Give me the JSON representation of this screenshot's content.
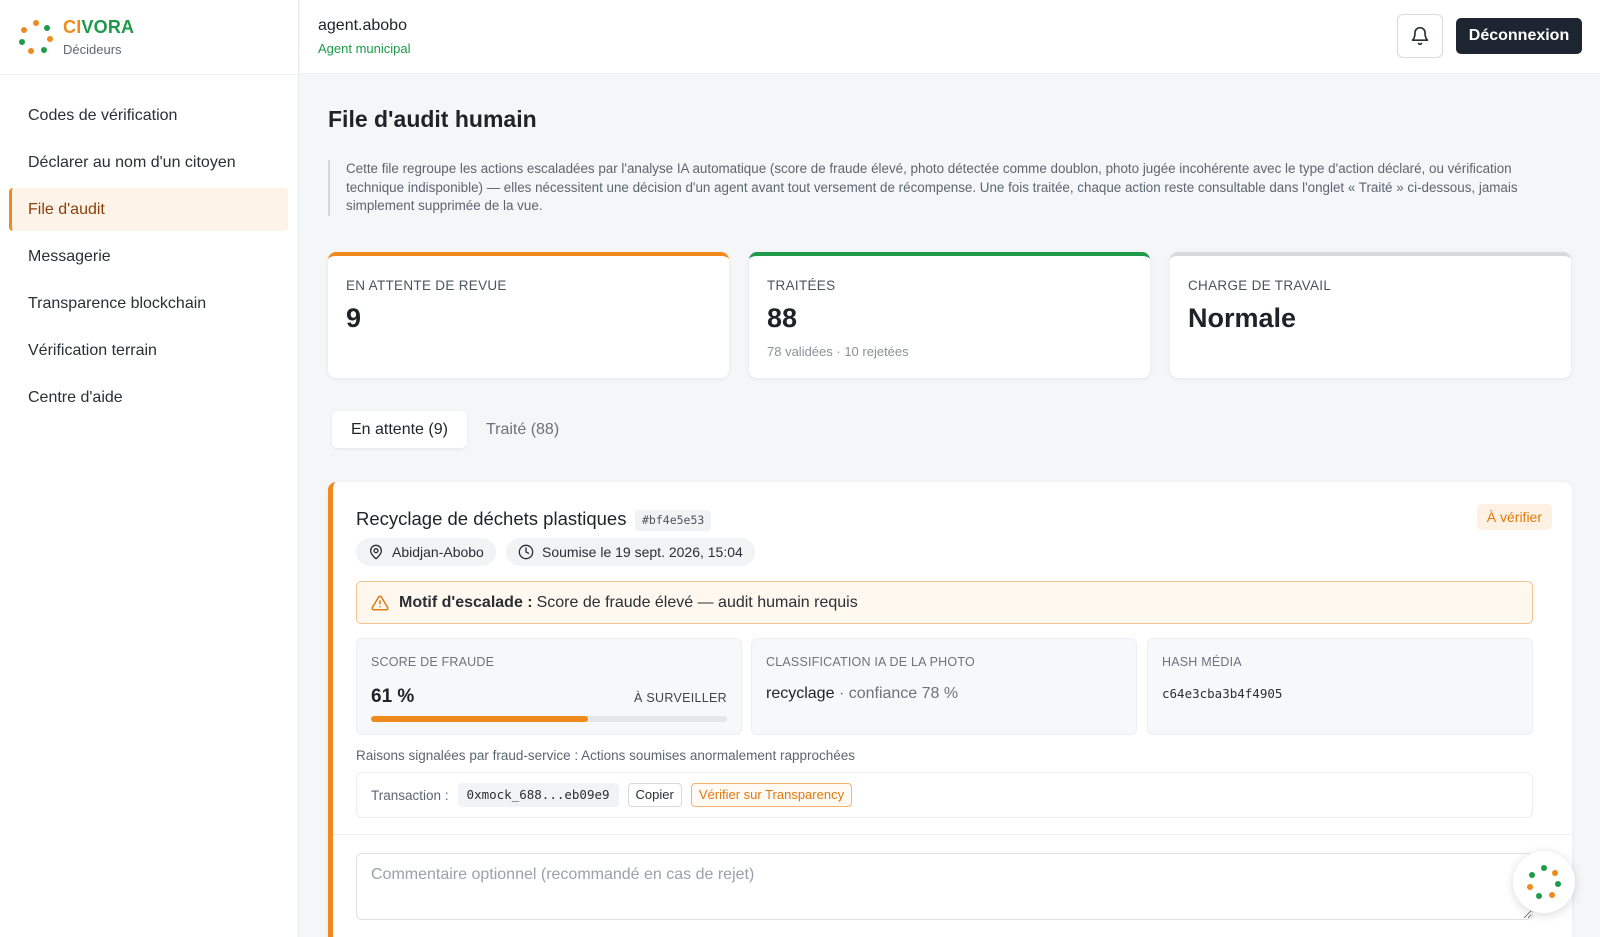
{
  "brand": {
    "name_part1": "CI",
    "name_part2": "VORA",
    "subtitle": "Décideurs",
    "colors": {
      "orange": "#f08a1c",
      "green": "#1e9a4b"
    }
  },
  "sidebar": {
    "items": [
      {
        "label": "Codes de vérification",
        "active": false
      },
      {
        "label": "Déclarer au nom d'un citoyen",
        "active": false
      },
      {
        "label": "File d'audit",
        "active": true
      },
      {
        "label": "Messagerie",
        "active": false
      },
      {
        "label": "Transparence blockchain",
        "active": false
      },
      {
        "label": "Vérification terrain",
        "active": false
      },
      {
        "label": "Centre d'aide",
        "active": false
      }
    ]
  },
  "header": {
    "user_name": "agent.abobo",
    "user_role": "Agent municipal",
    "bell_icon": "bell-icon",
    "logout_label": "Déconnexion"
  },
  "page": {
    "title": "File d'audit humain",
    "intro": "Cette file regroupe les actions escaladées par l'analyse IA automatique (score de fraude élevé, photo détectée comme doublon, photo jugée incohérente avec le type d'action déclaré, ou vérification technique indisponible) — elles nécessitent une décision d'un agent avant tout versement de récompense. Une fois traitée, chaque action reste consultable dans l'onglet « Traité » ci-dessous, jamais simplement supprimée de la vue."
  },
  "stats": [
    {
      "label": "EN ATTENTE DE REVUE",
      "value": "9",
      "sub": ""
    },
    {
      "label": "TRAITÉES",
      "value": "88",
      "sub": "78 validées · 10 rejetées"
    },
    {
      "label": "CHARGE DE TRAVAIL",
      "value": "Normale",
      "sub": ""
    }
  ],
  "tabs": [
    {
      "label": "En attente (9)",
      "active": true
    },
    {
      "label": "Traité (88)",
      "active": false
    }
  ],
  "card": {
    "title": "Recyclage de déchets plastiques",
    "id": "#bf4e5e53",
    "status": "À vérifier",
    "location": "Abidjan-Abobo",
    "location_icon": "map-pin-icon",
    "submitted": "Soumise le 19 sept. 2026, 15:04",
    "submitted_icon": "clock-icon",
    "alert_icon": "warning-icon",
    "alert_label": "Motif d'escalade :",
    "alert_text": "Score de fraude élevé — audit humain requis",
    "fraud": {
      "label": "SCORE DE FRAUDE",
      "value_text": "61 %",
      "value": 0.61,
      "level": "À SURVEILLER"
    },
    "classification": {
      "label": "CLASSIFICATION IA DE LA PHOTO",
      "category": "recyclage",
      "confidence": "· confiance 78 %"
    },
    "hash": {
      "label": "HASH MÉDIA",
      "value": "c64e3cba3b4f4905"
    },
    "reasons": "Raisons signalées par fraud-service : Actions soumises anormalement rapprochées",
    "transaction": {
      "label": "Transaction :",
      "hash": "0xmock_688...eb09e9",
      "copy_label": "Copier",
      "verify_label": "Vérifier sur Transparency"
    },
    "comment_placeholder": "Commentaire optionnel (recommandé en cas de rejet)"
  },
  "fab": {
    "icon": "civora-logo-icon"
  }
}
